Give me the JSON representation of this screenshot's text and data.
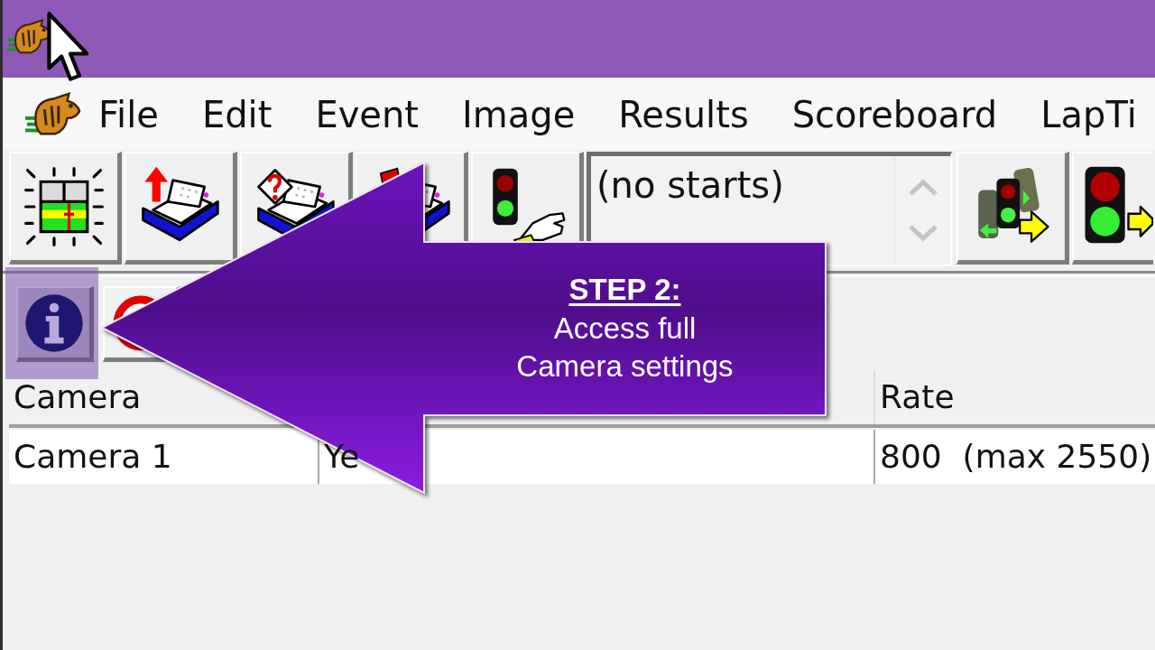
{
  "menu_bar": {
    "items": [
      {
        "label": "File"
      },
      {
        "label": "Edit"
      },
      {
        "label": "Event"
      },
      {
        "label": "Image"
      },
      {
        "label": "Results"
      },
      {
        "label": "Scoreboard"
      },
      {
        "label": "LapTi"
      }
    ]
  },
  "toolbar": {
    "start_list": {
      "value": "(no starts)"
    }
  },
  "toolbar_2": {
    "info_button": {
      "highlighted": true
    }
  },
  "table": {
    "columns": [
      {
        "label": "Camera"
      },
      {},
      {
        "label": "Rate"
      }
    ],
    "rows": [
      [
        "Camera 1",
        "Ye",
        "800  (max 2550)"
      ]
    ]
  },
  "callout": {
    "heading": "STEP 2:",
    "text": "Access full Camera settings"
  }
}
